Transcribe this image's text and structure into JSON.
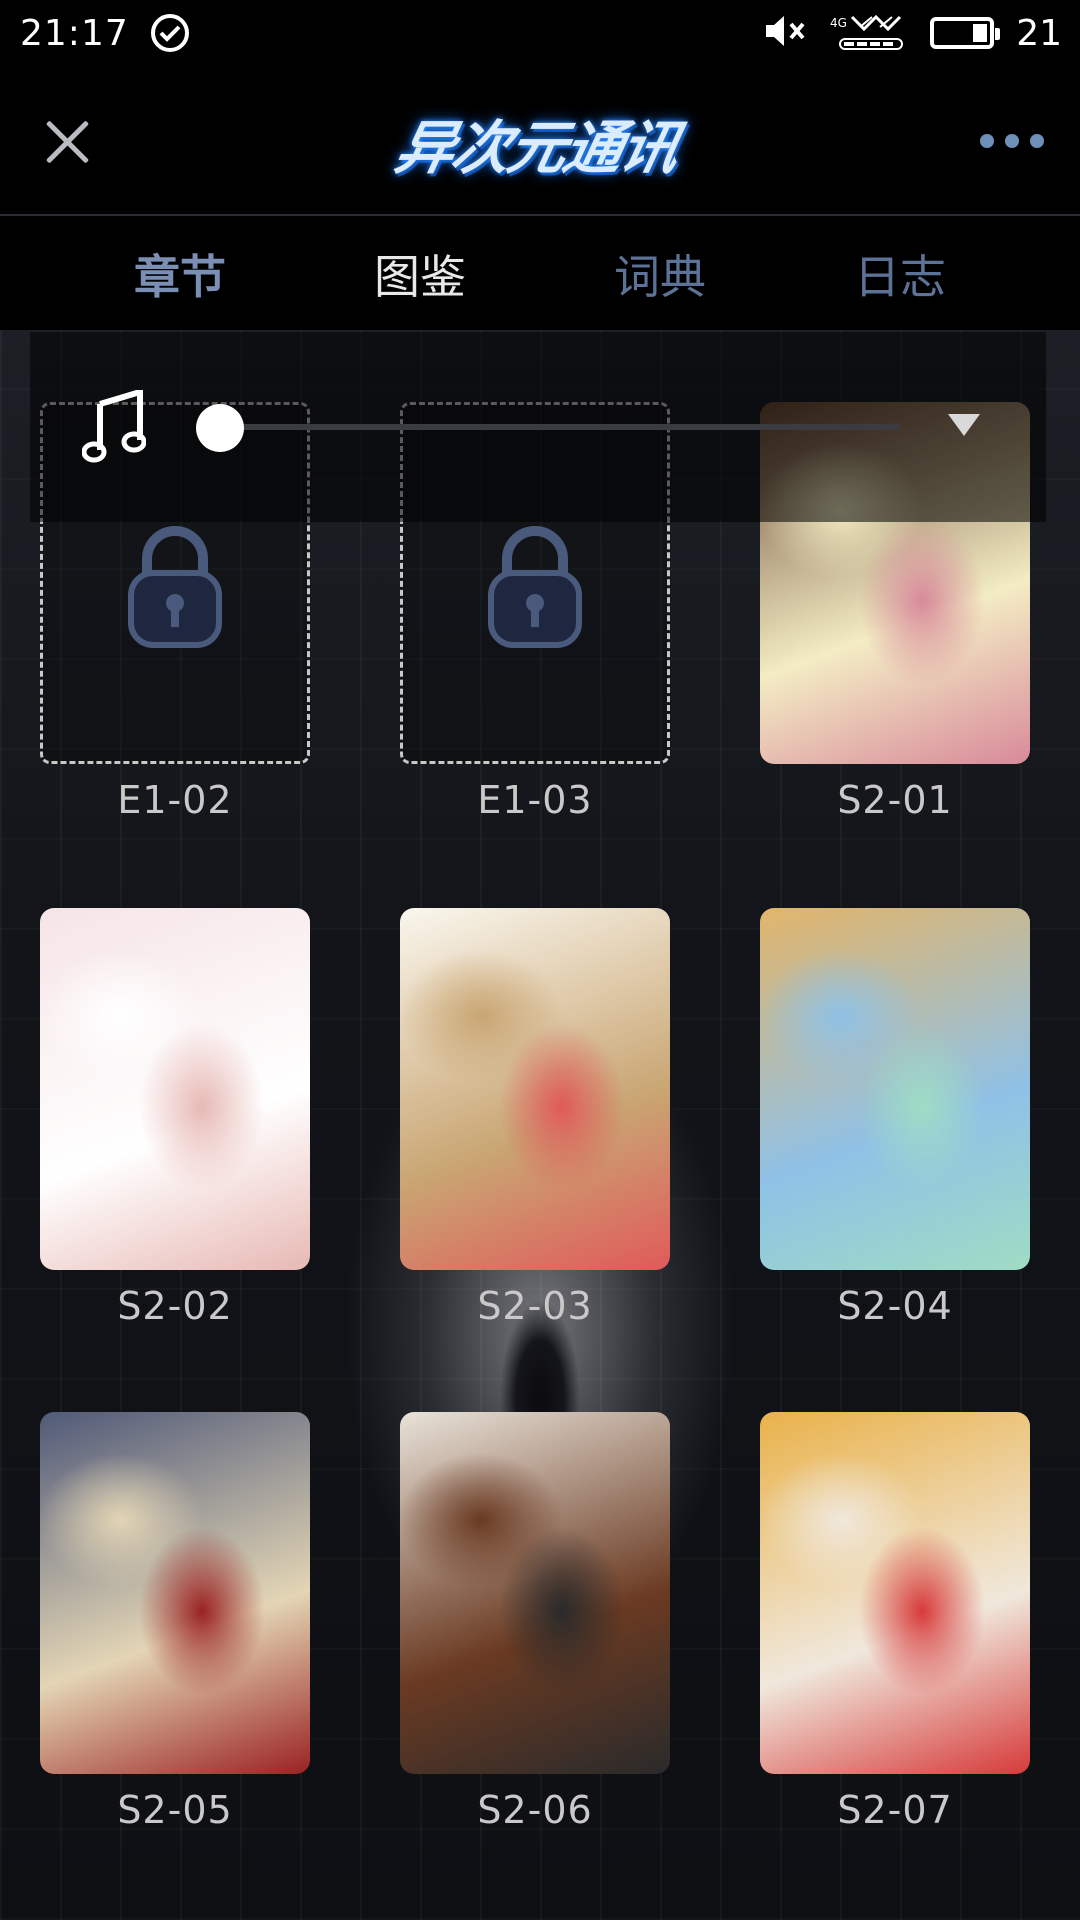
{
  "status_bar": {
    "time": "21:17",
    "battery": "21",
    "network": "4G",
    "icons": [
      "check-circle-icon",
      "mute-icon",
      "signal-icon",
      "battery-icon"
    ]
  },
  "header": {
    "logo_text": "异次元通讯",
    "close_icon": "close-icon",
    "more_icon": "more-icon"
  },
  "tabs": [
    {
      "label": "章节",
      "state": "active"
    },
    {
      "label": "图鉴",
      "state": "highlight"
    },
    {
      "label": "词典",
      "state": "normal"
    },
    {
      "label": "日志",
      "state": "normal"
    }
  ],
  "music_player": {
    "icon": "music-note-icon",
    "progress": 0,
    "dropdown_icon": "dropdown-triangle-icon"
  },
  "gallery": [
    {
      "label": "E1-02",
      "locked": true
    },
    {
      "label": "E1-03",
      "locked": true
    },
    {
      "label": "S2-01",
      "locked": false,
      "colors": [
        "#6b4a34",
        "#f3ecc4",
        "#d88a9a"
      ]
    },
    {
      "label": "S2-02",
      "locked": false,
      "colors": [
        "#f6e4e6",
        "#ffffff",
        "#e7b9b4"
      ]
    },
    {
      "label": "S2-03",
      "locked": false,
      "colors": [
        "#faf7ee",
        "#c9a673",
        "#e05a5a"
      ]
    },
    {
      "label": "S2-04",
      "locked": false,
      "colors": [
        "#e2b56a",
        "#8fc1e6",
        "#9fdcc4"
      ]
    },
    {
      "label": "S2-05",
      "locked": false,
      "colors": [
        "#505a78",
        "#e3d5b5",
        "#9a2222"
      ]
    },
    {
      "label": "S2-06",
      "locked": false,
      "colors": [
        "#e9e3d9",
        "#6a3a22",
        "#2a2a2a"
      ]
    },
    {
      "label": "S2-07",
      "locked": false,
      "colors": [
        "#e9b24a",
        "#f0e8dc",
        "#d73a3a"
      ]
    }
  ],
  "colors": {
    "tab_text": "#5d7297",
    "tab_active": "#7b8fb4",
    "tab_highlight": "#e8e8e8",
    "label_text": "#c9c9c9",
    "accent_blue": "#2c8cff"
  }
}
